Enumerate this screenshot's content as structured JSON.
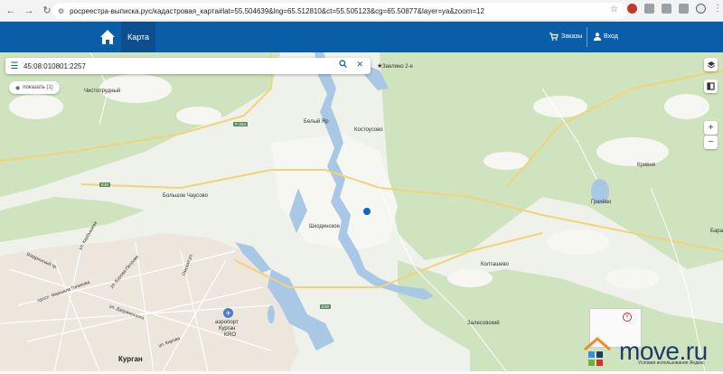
{
  "browser": {
    "url": "росреестра-выписка.рус/кадастровая_карта#lat=55.504639&lng=65.512810&ct=55.505123&cg=65.50877&layer=ya&zoom=12"
  },
  "header": {
    "tab_label": "Карта",
    "orders_label": "Заказы",
    "login_label": "Вход",
    "brand_color": "#0a5ea8"
  },
  "search": {
    "value": "45:08:010801:2257"
  },
  "show_button": {
    "label": "показать (1)"
  },
  "controls": {
    "zoom_in": "+",
    "zoom_out": "−"
  },
  "map_labels": {
    "chistoprudny": "Чистопрудный",
    "bely_yar": "Белый Яр",
    "kostousovo": "Костоусово",
    "zaelino": "Заелино 2-е",
    "bolshoe_chausovo": "Большое Чаусово",
    "shkodinskoe": "Шкодинское",
    "grachevo": "Грачёво",
    "krivnya": "Кривня",
    "bara": "Бара",
    "koltashevo": "Колташево",
    "zalesovsky": "Залесовский",
    "kurgan": "Курган",
    "airport_1": "аэропорт",
    "airport_2": "Курган",
    "airport_3": "KRO",
    "road_r254": "Р-254",
    "road_e30": "E30",
    "road_r254b": "Р-254",
    "road_e30b": "E30",
    "street_1": "ул. Карбышева",
    "street_2": "Шадринский тр.",
    "street_3": "просп. Маршала Голикова",
    "street_4": "ул. Бурова-Петрова",
    "street_5": "Омская ул.",
    "street_6": "ул. Дзержинского",
    "street_7": "ул. Кирова"
  },
  "watermark": {
    "brand": "move.ru",
    "yandex_attr": "Условия использования  Яндекс"
  }
}
